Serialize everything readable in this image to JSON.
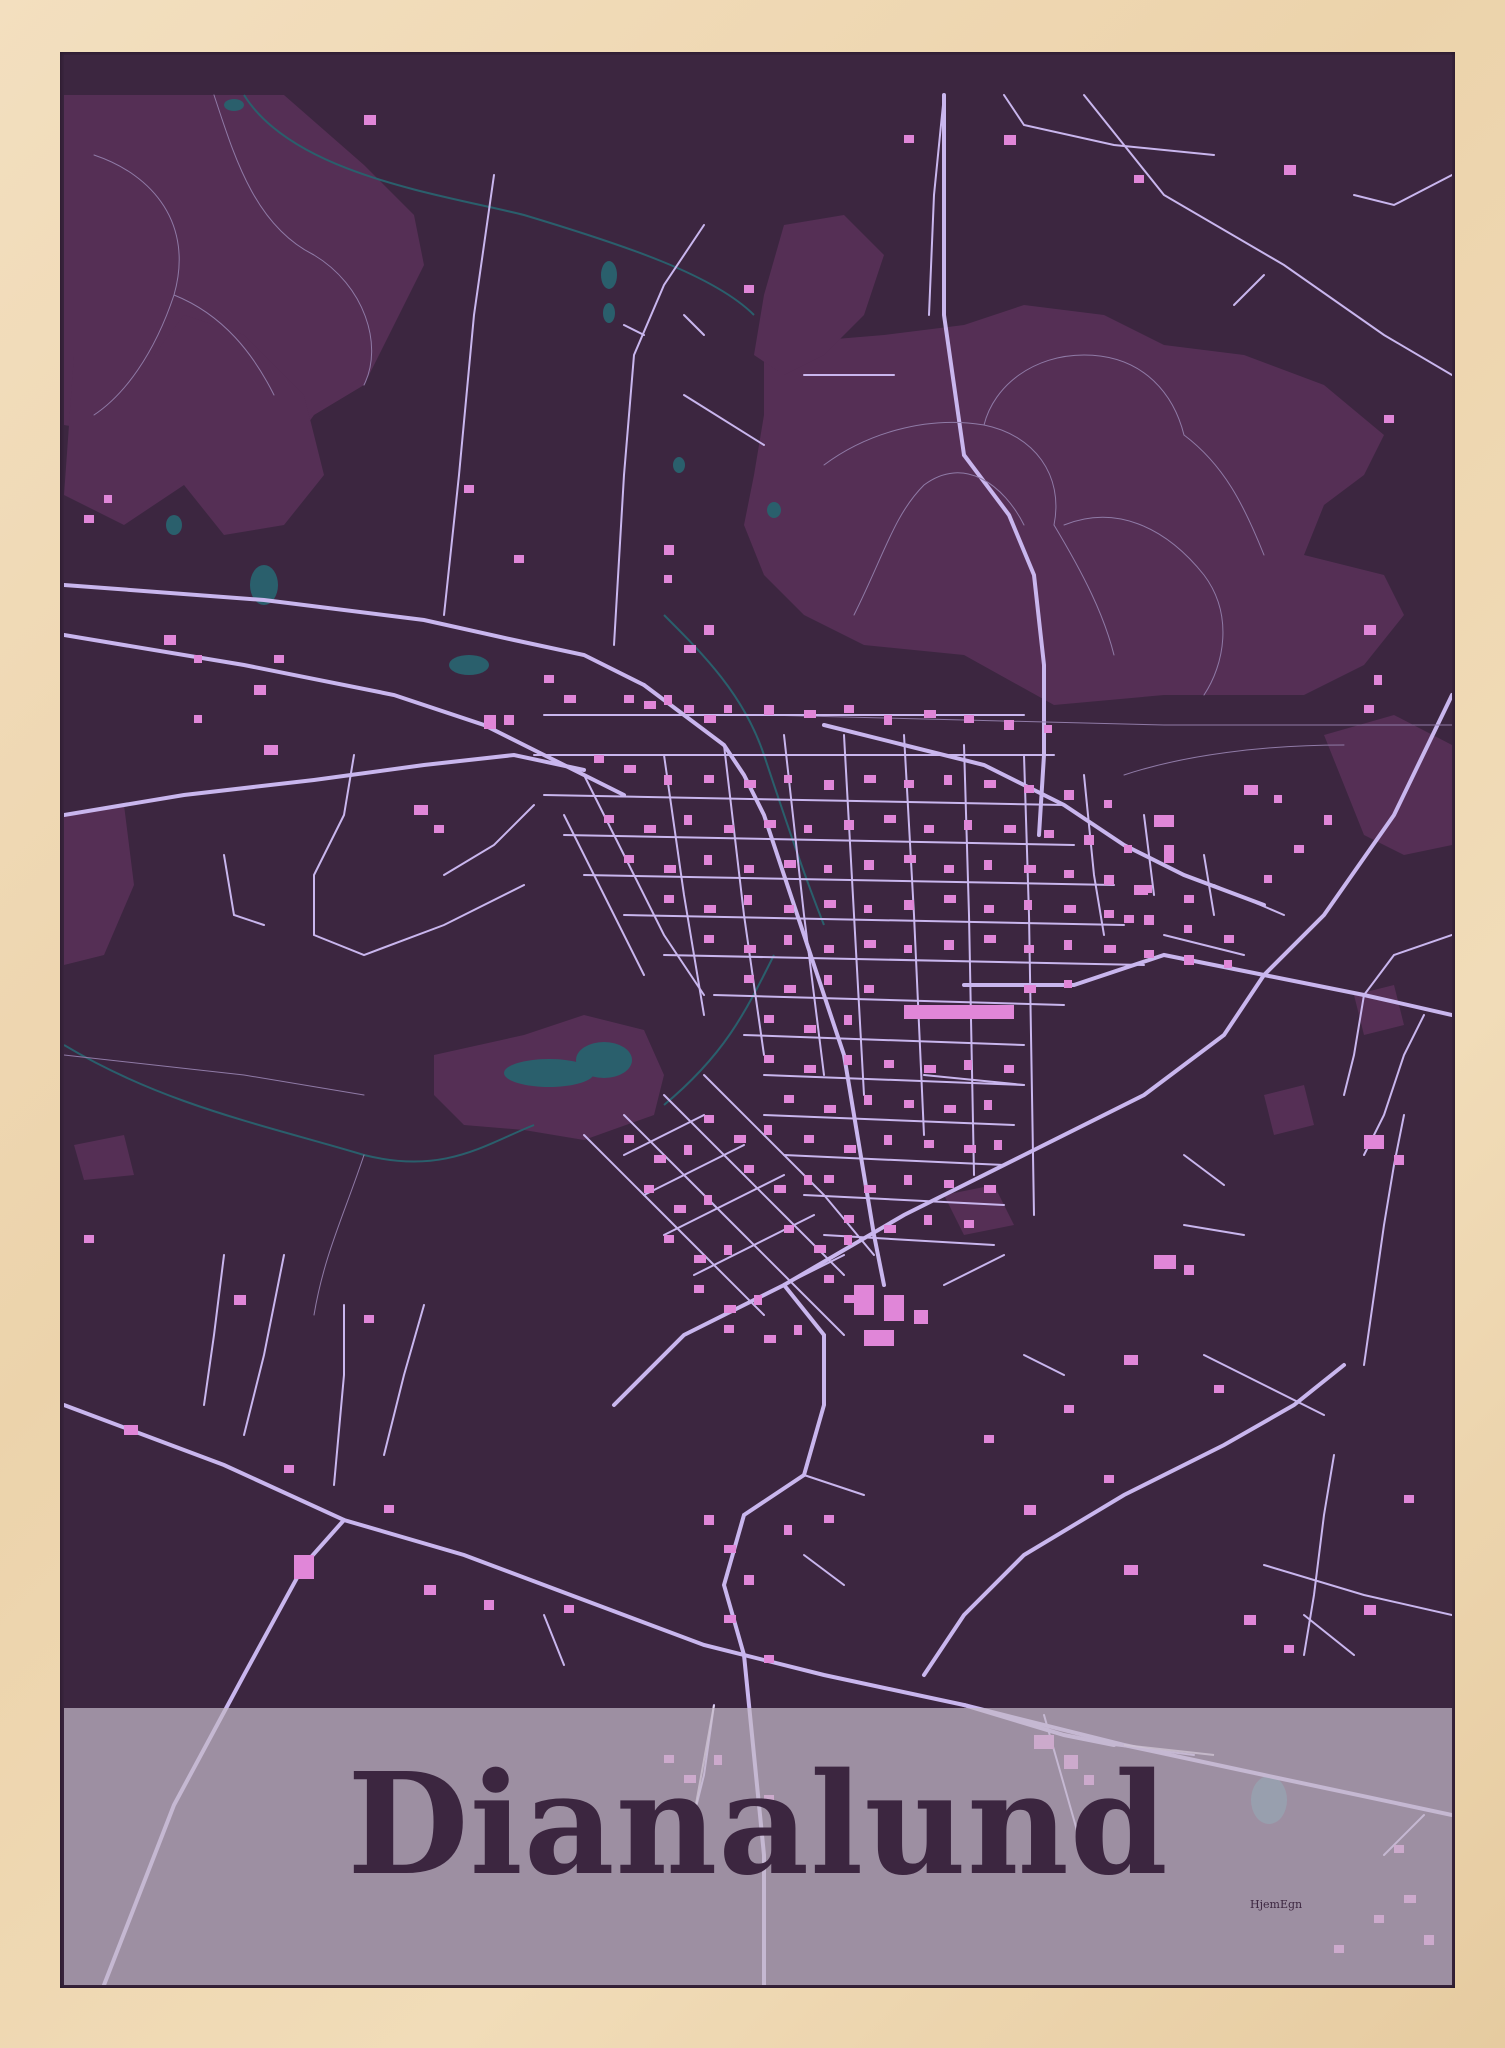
{
  "poster": {
    "title": "Dianalund",
    "maker_logo": "HjemEgn",
    "colors": {
      "background": "#3c2640",
      "forest": "#552f55",
      "roads": "#c9b6ee",
      "buildings": "#e086d8",
      "water": "#2a5f6c",
      "title_band": "#c4b9c8",
      "title_text": "#3c2640",
      "frame": "#efd9b4"
    }
  }
}
